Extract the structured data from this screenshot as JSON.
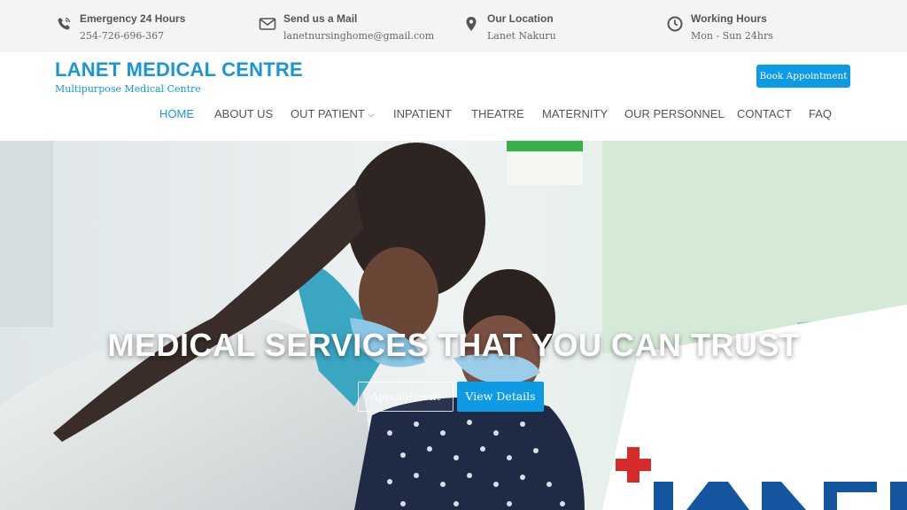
{
  "topbar": {
    "emergency": {
      "icon": "phone-icon",
      "title": "Emergency 24 Hours",
      "value": "254-726-696-367"
    },
    "mail": {
      "icon": "envelope-icon",
      "title": "Send us a Mail",
      "value": "lanetnursinghome@gmail.com"
    },
    "location": {
      "icon": "map-pin-icon",
      "title": "Our Location",
      "value": "Lanet Nakuru"
    },
    "hours": {
      "icon": "clock-icon",
      "title": "Working Hours",
      "value": "Mon - Sun 24hrs"
    }
  },
  "header": {
    "brand": "LANET MEDICAL CENTRE",
    "tagline": "Multipurpose Medical Centre",
    "book_label": "Book Appointment"
  },
  "nav": {
    "items": [
      "HOME",
      "ABOUT US",
      "OUT PATIENT",
      "INPATIENT",
      "THEATRE",
      "MATERNITY",
      "OUR PERSONNEL",
      "CONTACT",
      "FAQ"
    ],
    "active": "HOME"
  },
  "hero": {
    "title": "MEDICAL SERVICES THAT YOU CAN TRUST",
    "appointment_label": "Appointment",
    "view_label": "View Details"
  },
  "colors": {
    "accent": "#1a95d6",
    "button": "#0e9be5",
    "topbar_bg": "#f4f4f4"
  }
}
